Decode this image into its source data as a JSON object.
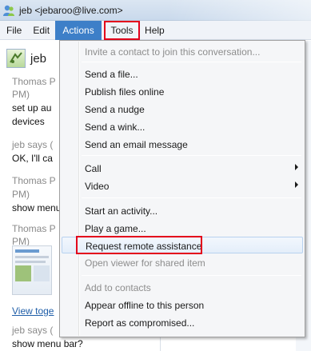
{
  "window": {
    "title": "jeb <jebaroo@live.com>"
  },
  "menubar": {
    "items": [
      "File",
      "Edit",
      "Actions",
      "Tools",
      "Help"
    ]
  },
  "conversation": {
    "buddy_name": "jeb",
    "lines": [
      {
        "text": "Thomas P",
        "kind": "meta"
      },
      {
        "text": "PM)",
        "kind": "meta"
      },
      {
        "text": "set up au",
        "kind": "msg"
      },
      {
        "text": "devices",
        "kind": "msg"
      },
      {
        "text": "jeb says (",
        "kind": "meta"
      },
      {
        "text": "OK, I'll ca",
        "kind": "msg"
      },
      {
        "text": "Thomas P",
        "kind": "meta"
      },
      {
        "text": "PM)",
        "kind": "meta"
      },
      {
        "text": "show menu",
        "kind": "msg"
      },
      {
        "text": "Thomas P",
        "kind": "meta"
      },
      {
        "text": "PM)",
        "kind": "meta"
      },
      {
        "text": "View toge",
        "kind": "link"
      },
      {
        "text": "jeb says (",
        "kind": "meta"
      },
      {
        "text": "show menu bar?",
        "kind": "msg"
      }
    ]
  },
  "actions_menu": {
    "items": [
      {
        "label": "Invite a contact to join this conversation...",
        "disabled": true
      },
      {
        "label": "Send a file...",
        "disabled": false
      },
      {
        "label": "Publish files online",
        "disabled": false
      },
      {
        "label": "Send a nudge",
        "disabled": false
      },
      {
        "label": "Send a wink...",
        "disabled": false
      },
      {
        "label": "Send an email message",
        "disabled": false
      },
      {
        "label": "Call",
        "disabled": false,
        "submenu": true
      },
      {
        "label": "Video",
        "disabled": false,
        "submenu": true
      },
      {
        "label": "Start an activity...",
        "disabled": false
      },
      {
        "label": "Play a game...",
        "disabled": false
      },
      {
        "label": "Request remote assistance",
        "disabled": false,
        "highlighted": true
      },
      {
        "label": "Open viewer for shared item",
        "disabled": true
      },
      {
        "label": "Add to contacts",
        "disabled": true
      },
      {
        "label": "Appear offline to this person",
        "disabled": false
      },
      {
        "label": "Report as compromised...",
        "disabled": false
      }
    ]
  },
  "colors": {
    "accent": "#3d7fc8",
    "annotation_red": "#e3001b"
  },
  "icons": {
    "app": "messenger-buddy-icon",
    "buddy": "buddy-avatar-icon"
  }
}
